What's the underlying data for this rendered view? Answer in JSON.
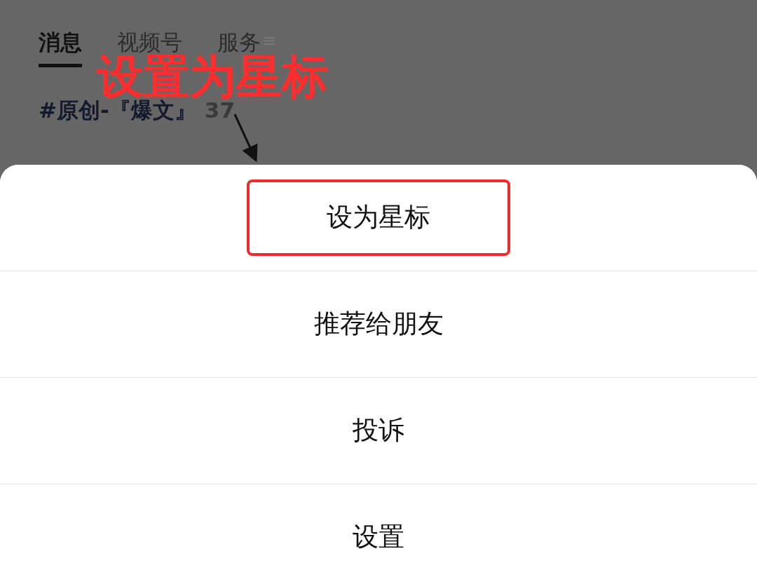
{
  "tabs": [
    {
      "label": "消息",
      "selected": true
    },
    {
      "label": "视频号",
      "selected": false
    },
    {
      "label": "服务",
      "selected": false
    }
  ],
  "menu_icon": "≡",
  "hashtag": {
    "title": "#原创-『爆文』",
    "count": "37"
  },
  "annotation": {
    "text": "设置为星标"
  },
  "action_sheet": {
    "items": [
      {
        "label": "设为星标",
        "highlighted": true
      },
      {
        "label": "推荐给朋友",
        "highlighted": false
      },
      {
        "label": "投诉",
        "highlighted": false
      },
      {
        "label": "设置",
        "highlighted": false
      }
    ]
  }
}
